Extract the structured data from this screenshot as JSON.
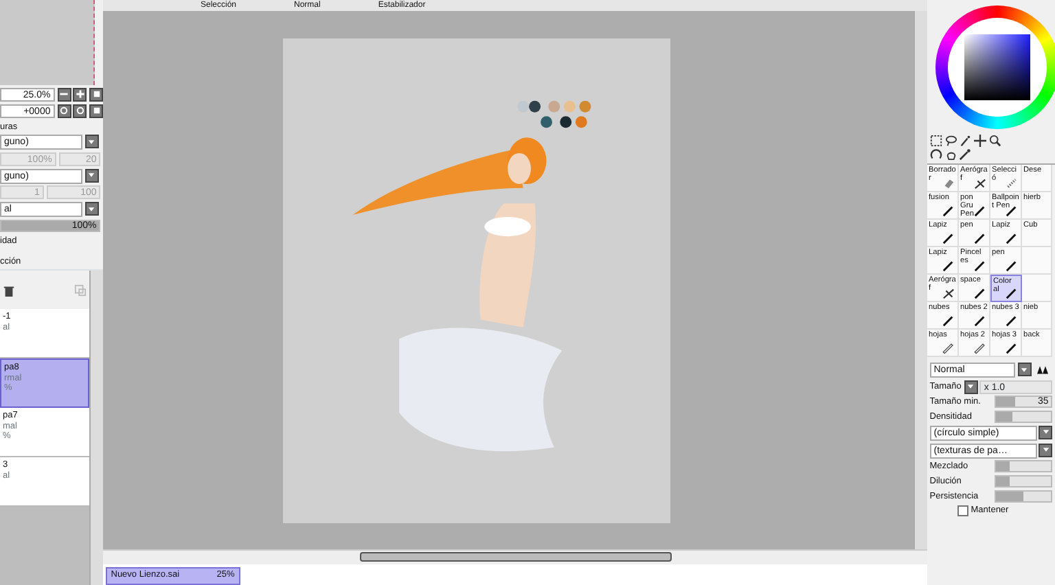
{
  "toolbar": {
    "items": [
      "Selección",
      "Normal",
      "Estabilizador"
    ]
  },
  "navigator": {
    "zoom": "25.0%",
    "rotation": "+0000"
  },
  "left_settings": {
    "texture_label": "uras",
    "texture_value": "guno)",
    "texture_fields": [
      "100%",
      "20"
    ],
    "effect_value": "guno)",
    "effect_fields": [
      "1",
      "100"
    ],
    "blend_mode": "al",
    "opacity": {
      "reading": "100%",
      "level": 1
    },
    "opacity_label": "idad",
    "protect_label": "cción"
  },
  "layers": [
    {
      "lines": [
        "-1",
        "al"
      ],
      "selected": false
    },
    {
      "lines": [
        "pa8",
        "rmal",
        "%"
      ],
      "selected": true
    },
    {
      "lines": [
        "pa7",
        "mal",
        "%"
      ],
      "selected": false
    },
    {
      "lines": [
        "3",
        "al"
      ],
      "selected": false
    }
  ],
  "document_tabs": [
    {
      "name": "Nuevo Lienzo.sai",
      "zoom": "25%",
      "selected": true
    }
  ],
  "brushes": [
    {
      "name": "Borrador",
      "kind": "eraser",
      "selected": false
    },
    {
      "name": "Aerógraf",
      "kind": "airbrush",
      "selected": false
    },
    {
      "name": "Selecció",
      "kind": "select",
      "selected": false
    },
    {
      "name": "Dese",
      "kind": "blank",
      "selected": false
    },
    {
      "name": "fusion",
      "kind": "pen",
      "selected": false
    },
    {
      "name": "pon Gru Pen",
      "kind": "pen",
      "selected": false
    },
    {
      "name": "Ballpoint Pen",
      "kind": "pen",
      "selected": false
    },
    {
      "name": "hierb",
      "kind": "blank",
      "selected": false
    },
    {
      "name": "Lapiz",
      "kind": "pen",
      "selected": false
    },
    {
      "name": "pen",
      "kind": "pen",
      "selected": false
    },
    {
      "name": "Lapiz",
      "kind": "pen",
      "selected": false
    },
    {
      "name": "Cub",
      "kind": "blank",
      "selected": false
    },
    {
      "name": "Lapiz",
      "kind": "pen",
      "selected": false
    },
    {
      "name": "Pincel es",
      "kind": "pen",
      "selected": false
    },
    {
      "name": "pen",
      "kind": "pen",
      "selected": false
    },
    {
      "kind": "empty",
      "selected": false
    },
    {
      "name": "Aerógraf",
      "kind": "airbrush",
      "selected": false
    },
    {
      "name": "space",
      "kind": "pen",
      "selected": false
    },
    {
      "name": "Color al",
      "kind": "pen",
      "selected": true
    },
    {
      "kind": "empty",
      "selected": false
    },
    {
      "name": "nubes",
      "kind": "pen",
      "selected": false
    },
    {
      "name": "nubes 2",
      "kind": "pen",
      "selected": false
    },
    {
      "name": "nubes 3",
      "kind": "pen",
      "selected": false
    },
    {
      "name": "nieb",
      "kind": "blank",
      "selected": false
    },
    {
      "name": "hojas",
      "kind": "pencil",
      "selected": false
    },
    {
      "name": "hojas 2",
      "kind": "pencil",
      "selected": false
    },
    {
      "name": "hojas 3",
      "kind": "pen",
      "selected": false
    },
    {
      "name": "back",
      "kind": "blank",
      "selected": false
    }
  ],
  "brush_settings": {
    "mode": "Normal",
    "size_label": "Tamaño",
    "size_multiplier": "x 1.0",
    "min_size": {
      "label": "Tamaño min.",
      "reading": "35",
      "level": 0.35
    },
    "density": {
      "label": "Densitidad",
      "level": 0.3
    },
    "shape": "(círculo simple)",
    "texture": "(texturas de pa…",
    "sliders": [
      {
        "label": "Mezclado",
        "level": 0.25
      },
      {
        "label": "Dilución",
        "level": 0.25
      },
      {
        "label": "Persistencia",
        "level": 0.5
      }
    ],
    "keep_opacity": {
      "label": "Mantener",
      "checked": false
    }
  }
}
